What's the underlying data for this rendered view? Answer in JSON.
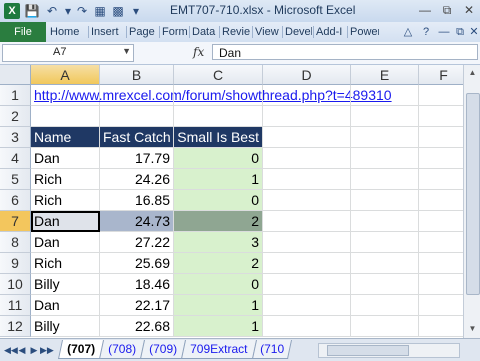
{
  "window": {
    "title": "EMT707-710.xlsx - Microsoft Excel",
    "app_icon": "excel-icon"
  },
  "ribbon": {
    "file": "File",
    "tabs": [
      "Home",
      "Insert",
      "Page",
      "Form",
      "Data",
      "Revie",
      "View",
      "Devel",
      "Add-I",
      "Power"
    ]
  },
  "formula_bar": {
    "name_box": "A7",
    "fx": "fx",
    "content": "Dan"
  },
  "columns": [
    "A",
    "B",
    "C",
    "D",
    "E",
    "F"
  ],
  "rows": [
    "1",
    "2",
    "3",
    "4",
    "5",
    "6",
    "7",
    "8",
    "9",
    "10",
    "11",
    "12"
  ],
  "sheet": {
    "url": "http://www.mrexcel.com/forum/showthread.php?t=489310",
    "headers": [
      "Name",
      "Fast Catch",
      "Small Is Best"
    ],
    "data": [
      [
        "Dan",
        "17.79",
        "0"
      ],
      [
        "Rich",
        "24.26",
        "1"
      ],
      [
        "Rich",
        "16.85",
        "0"
      ],
      [
        "Dan",
        "24.73",
        "2"
      ],
      [
        "Dan",
        "27.22",
        "3"
      ],
      [
        "Rich",
        "25.69",
        "2"
      ],
      [
        "Billy",
        "18.46",
        "0"
      ],
      [
        "Dan",
        "22.17",
        "1"
      ],
      [
        "Billy",
        "22.68",
        "1"
      ]
    ]
  },
  "sheet_tabs": [
    "(707)",
    "(708)",
    "(709)",
    "709Extract",
    "(710"
  ]
}
